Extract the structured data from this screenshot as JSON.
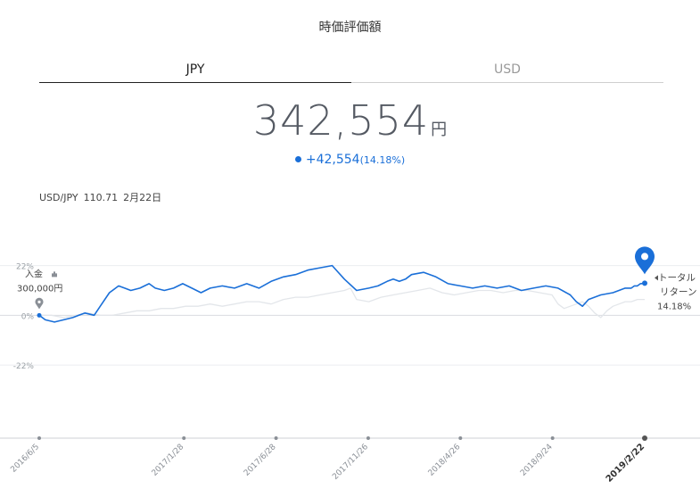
{
  "header": {
    "title": "時価評価額"
  },
  "tabs": [
    {
      "label": "JPY",
      "active": true
    },
    {
      "label": "USD",
      "active": false
    }
  ],
  "valuation": {
    "amount": "342,554",
    "unit": "円",
    "change": "+42,554",
    "change_pct": "(14.18%)",
    "accent_color": "#1a6fd8"
  },
  "fx": {
    "pair": "USD/JPY",
    "rate": "110.71",
    "date": "2月22日"
  },
  "chart_data": {
    "type": "line",
    "y_tick_labels": [
      "22%",
      "0%",
      "-22%"
    ],
    "y_ticks": [
      22,
      0,
      -22
    ],
    "ylim": [
      -35,
      25
    ],
    "x_tick_labels": [
      "2016/6/5",
      "2017/1/28",
      "2017/6/28",
      "2017/11/26",
      "2018/4/26",
      "2018/9/24",
      "2019/2/22"
    ],
    "x_ticks": [
      0,
      237,
      388,
      539,
      690,
      841,
      992
    ],
    "xlim": [
      0,
      992
    ],
    "deposit_label": "入金",
    "deposit_amount": "300,000円",
    "end_label": "トータル\nリターン",
    "end_pct": "14.18%",
    "series": [
      {
        "color": "#1a6fd8",
        "x": [
          0,
          10,
          25,
          40,
          55,
          65,
          75,
          90,
          100,
          115,
          130,
          140,
          150,
          165,
          180,
          190,
          205,
          220,
          235,
          250,
          265,
          280,
          300,
          320,
          340,
          360,
          380,
          400,
          420,
          440,
          460,
          480,
          500,
          520,
          540,
          555,
          570,
          580,
          590,
          600,
          610,
          630,
          650,
          670,
          690,
          710,
          730,
          750,
          770,
          790,
          810,
          830,
          850,
          870,
          880,
          890,
          900,
          920,
          940,
          960,
          970,
          975,
          980,
          985,
          992
        ],
        "values": [
          0,
          -2,
          -3,
          -2,
          -1,
          0,
          1,
          0,
          4,
          10,
          13,
          12,
          11,
          12,
          14,
          12,
          11,
          12,
          14,
          12,
          10,
          12,
          13,
          12,
          14,
          12,
          15,
          17,
          18,
          20,
          21,
          22,
          16,
          11,
          12,
          13,
          15,
          16,
          15,
          16,
          18,
          19,
          17,
          14,
          13,
          12,
          13,
          12,
          13,
          11,
          12,
          13,
          12,
          9,
          6,
          4,
          7,
          9,
          10,
          12,
          12,
          13,
          13,
          14,
          14.18
        ]
      },
      {
        "color": "#e3e6ea",
        "x": [
          0,
          20,
          40,
          60,
          80,
          100,
          120,
          140,
          160,
          180,
          200,
          220,
          240,
          260,
          280,
          300,
          320,
          340,
          360,
          380,
          400,
          420,
          440,
          460,
          480,
          500,
          510,
          520,
          540,
          560,
          580,
          600,
          620,
          640,
          660,
          680,
          700,
          720,
          740,
          760,
          780,
          800,
          820,
          840,
          850,
          860,
          870,
          880,
          890,
          900,
          910,
          920,
          930,
          940,
          950,
          960,
          970,
          980,
          992
        ],
        "values": [
          0,
          0,
          -1,
          0,
          1,
          0,
          0,
          1,
          2,
          2,
          3,
          3,
          4,
          4,
          5,
          4,
          5,
          6,
          6,
          5,
          7,
          8,
          8,
          9,
          10,
          11,
          12,
          7,
          6,
          8,
          9,
          10,
          11,
          12,
          10,
          9,
          10,
          11,
          11,
          10,
          11,
          11,
          10,
          9,
          5,
          3,
          4,
          5,
          6,
          4,
          1,
          -1,
          2,
          4,
          5,
          6,
          6,
          7,
          7
        ]
      }
    ],
    "grid": true
  }
}
